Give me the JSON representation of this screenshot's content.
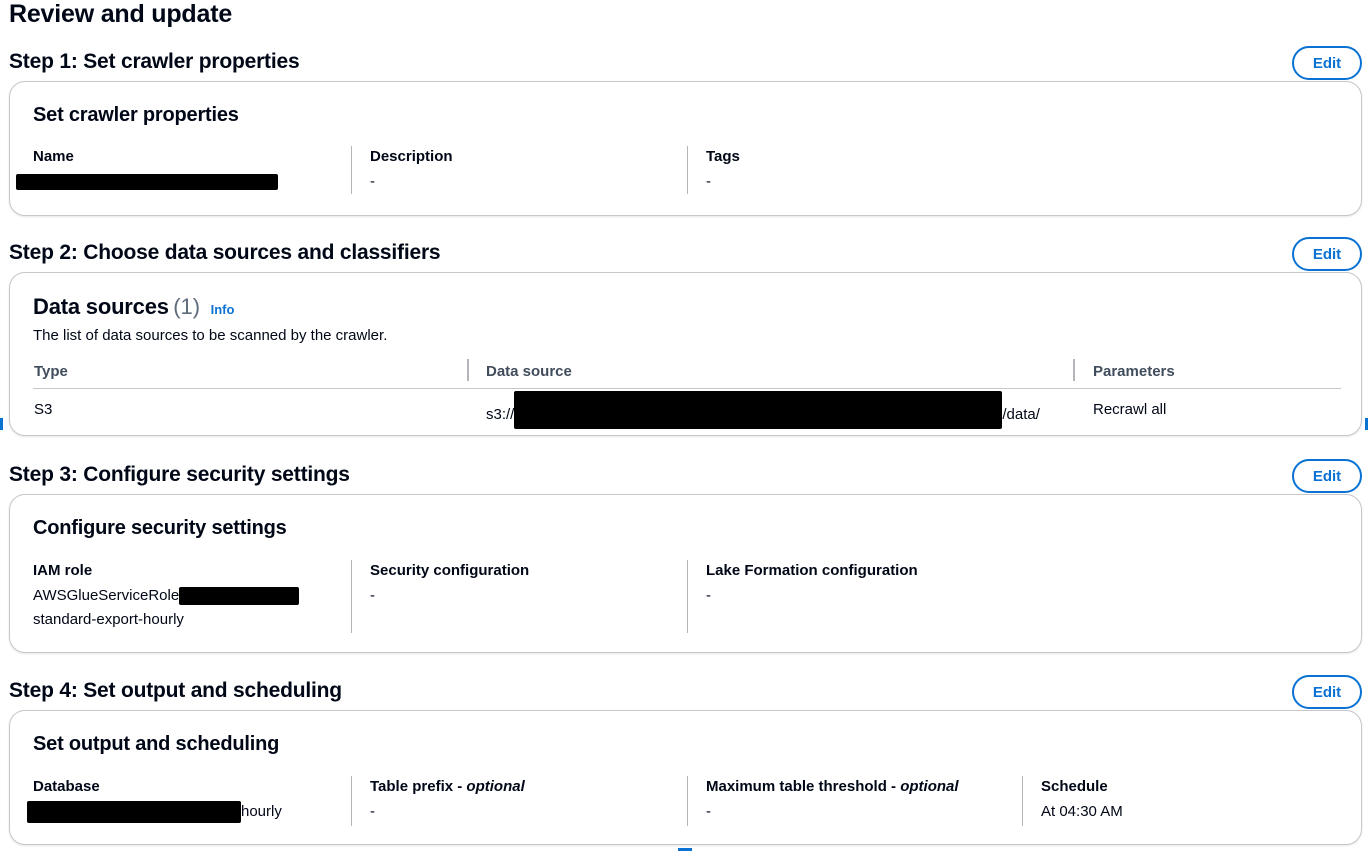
{
  "page_title": "Review and update",
  "edit_label": "Edit",
  "step1": {
    "title": "Step 1: Set crawler properties",
    "card_title": "Set crawler properties",
    "fields": [
      {
        "label": "Name",
        "value": ""
      },
      {
        "label": "Description",
        "value": "-"
      },
      {
        "label": "Tags",
        "value": "-"
      }
    ]
  },
  "step2": {
    "title": "Step 2: Choose data sources and classifiers",
    "card_title": "Data sources",
    "count": "(1)",
    "info": "Info",
    "description": "The list of data sources to be scanned by the crawler.",
    "columns": [
      "Type",
      "Data source",
      "Parameters"
    ],
    "rows": [
      {
        "type": "S3",
        "source_prefix": "s3://",
        "source_suffix": "/data/",
        "parameters": "Recrawl all"
      }
    ]
  },
  "step3": {
    "title": "Step 3: Configure security settings",
    "card_title": "Configure security settings",
    "fields": [
      {
        "label": "IAM role",
        "value_line1": "AWSGlueServiceRole",
        "value_line2": "standard-export-hourly"
      },
      {
        "label": "Security configuration",
        "value": "-"
      },
      {
        "label": "Lake Formation configuration",
        "value": "-"
      }
    ]
  },
  "step4": {
    "title": "Step 4: Set output and scheduling",
    "card_title": "Set output and scheduling",
    "fields": [
      {
        "label": "Database",
        "value_suffix": "hourly"
      },
      {
        "label": "Table prefix - ",
        "optional": "optional",
        "value": "-"
      },
      {
        "label": "Maximum table threshold - ",
        "optional": "optional",
        "value": "-"
      },
      {
        "label": "Schedule",
        "value": "At 04:30 AM"
      }
    ]
  }
}
